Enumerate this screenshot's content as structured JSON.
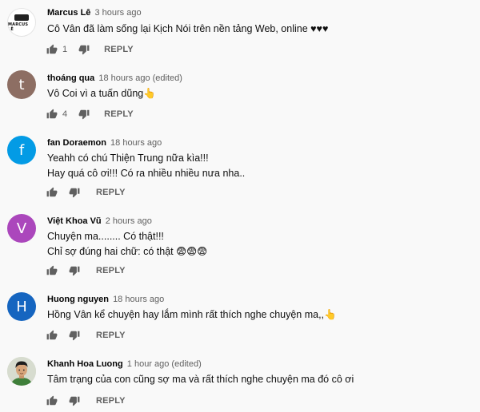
{
  "comments": [
    {
      "author": "Marcus Lê",
      "meta": "3 hours ago",
      "avatar_letter": "",
      "avatar_color": "#ffffff",
      "avatar_logo_text": "MARCUS LÊ",
      "text": [
        "Cô Vân đã làm sống lại Kịch Nói trên nền tảng Web, online ♥♥♥"
      ],
      "likes": "1",
      "reply_label": "REPLY"
    },
    {
      "author": "thoáng qua",
      "meta": "18 hours ago (edited)",
      "avatar_letter": "t",
      "avatar_color": "#8d6e63",
      "text": [
        "Vô Coi vì a tuấn dũng👆"
      ],
      "likes": "4",
      "reply_label": "REPLY"
    },
    {
      "author": "fan Doraemon",
      "meta": "18 hours ago",
      "avatar_letter": "f",
      "avatar_color": "#039be5",
      "text": [
        "Yeahh có chú Thiện Trung nữa kìa!!!",
        "Hay quá cô ơi!!! Có ra nhiều nhiều nưa nha.."
      ],
      "likes": "",
      "reply_label": "REPLY"
    },
    {
      "author": "Việt Khoa Vũ",
      "meta": "2 hours ago",
      "avatar_letter": "V",
      "avatar_color": "#ab47bc",
      "text": [
        "Chuyện ma........  Có thật!!!",
        "Chỉ sợ đúng hai chữ: có thật 😨😨😨"
      ],
      "likes": "",
      "reply_label": "REPLY"
    },
    {
      "author": "Huong nguyen",
      "meta": "18 hours ago",
      "avatar_letter": "H",
      "avatar_color": "#1565c0",
      "text": [
        "Hồng Vân kể chuyện hay lắm mình rất thích nghe chuyện ma,,👆"
      ],
      "likes": "",
      "reply_label": "REPLY"
    },
    {
      "author": "Khanh Hoa Luong",
      "meta": "1 hour ago (edited)",
      "avatar_letter": "",
      "avatar_color": "#cfd6c8",
      "text": [
        "Tâm trạng của con cũng sợ ma và rất thích nghe chuyện ma đó cô ơi"
      ],
      "likes": "",
      "reply_label": "REPLY"
    }
  ]
}
